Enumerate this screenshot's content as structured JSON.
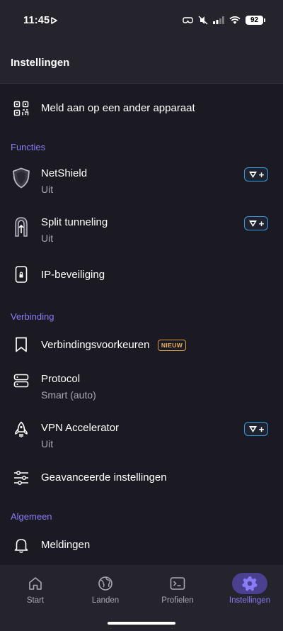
{
  "status_bar": {
    "time": "11:45",
    "battery": "92"
  },
  "header": {
    "title": "Instellingen"
  },
  "sign_in_item": {
    "label": "Meld aan op een ander apparaat",
    "icon": "qr-code-icon"
  },
  "sections": {
    "functies": "Functies",
    "verbinding": "Verbinding",
    "algemeen": "Algemeen"
  },
  "items": {
    "netshield": {
      "label": "NetShield",
      "value": "Uit",
      "icon": "shield-icon",
      "badge": "+"
    },
    "split_tunneling": {
      "label": "Split tunneling",
      "value": "Uit",
      "icon": "split-tunnel-icon",
      "badge": "+"
    },
    "ip_protection": {
      "label": "IP-beveiliging",
      "icon": "phone-lock-icon"
    },
    "connection_prefs": {
      "label": "Verbindingsvoorkeuren",
      "icon": "bookmark-icon",
      "badge": "NIEUW"
    },
    "protocol": {
      "label": "Protocol",
      "value": "Smart (auto)",
      "icon": "server-icon"
    },
    "vpn_accelerator": {
      "label": "VPN Accelerator",
      "value": "Uit",
      "icon": "rocket-icon",
      "badge": "+"
    },
    "advanced": {
      "label": "Geavanceerde instellingen",
      "icon": "sliders-icon"
    },
    "notifications": {
      "label": "Meldingen",
      "icon": "bell-icon"
    }
  },
  "tabbar": {
    "tabs": [
      {
        "label": "Start",
        "icon": "home-icon",
        "active": false
      },
      {
        "label": "Landen",
        "icon": "globe-icon",
        "active": false
      },
      {
        "label": "Profielen",
        "icon": "terminal-icon",
        "active": false
      },
      {
        "label": "Instellingen",
        "icon": "gear-icon",
        "active": true
      }
    ]
  },
  "colors": {
    "background": "#1b1a22",
    "surface": "#25242d",
    "accent": "#8a7cf6",
    "plus_border": "#3a9de0",
    "new_badge": "#d8a04a"
  }
}
